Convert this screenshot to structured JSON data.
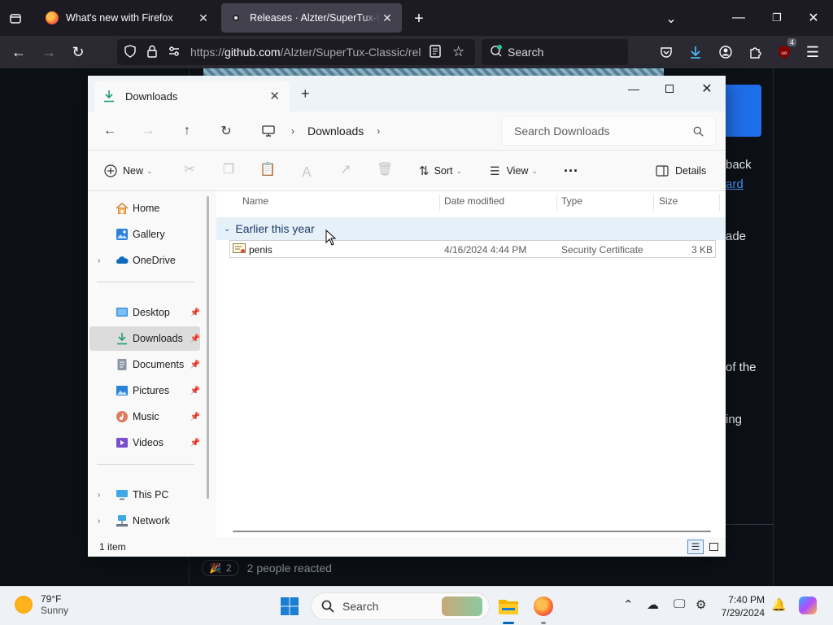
{
  "browser": {
    "tabs": [
      {
        "title": "What's new with Firefox",
        "active": false
      },
      {
        "title": "Releases · Alzter/SuperTux-Classic",
        "active": true
      }
    ],
    "url": "https://github.com/Alzter/SuperTux-Classic/rel",
    "url_host": "github.com",
    "url_prefix": "https://",
    "url_path": "/Alzter/SuperTux-Classic/rel",
    "search_placeholder": "Search",
    "extension_badge": "4"
  },
  "webpage": {
    "fragments": [
      "back",
      "ard",
      "ade",
      "of the",
      "ing"
    ],
    "reaction_count": "2",
    "reaction_text": "2 people reacted"
  },
  "explorer": {
    "tab_title": "Downloads",
    "breadcrumb": [
      "Downloads"
    ],
    "search_placeholder": "Search Downloads",
    "toolbar": {
      "new": "New",
      "sort": "Sort",
      "view": "View",
      "details": "Details"
    },
    "sidebar": {
      "top": [
        "Home",
        "Gallery",
        "OneDrive"
      ],
      "pinned": [
        "Desktop",
        "Downloads",
        "Documents",
        "Pictures",
        "Music",
        "Videos"
      ],
      "bottom": [
        "This PC",
        "Network"
      ],
      "selected": "Downloads"
    },
    "columns": [
      "Name",
      "Date modified",
      "Type",
      "Size"
    ],
    "group": "Earlier this year",
    "files": [
      {
        "name": "penis",
        "date": "4/16/2024 4:44 PM",
        "type": "Security Certificate",
        "size": "3 KB"
      }
    ],
    "status": "1 item"
  },
  "taskbar": {
    "weather_temp": "79°F",
    "weather_desc": "Sunny",
    "search_placeholder": "Search",
    "time": "7:40 PM",
    "date": "7/29/2024"
  },
  "colors": {
    "firefox_bg": "#1c1b22",
    "github_bg": "#0d1117",
    "explorer_bg": "#f9f9f9",
    "group_header": "#e6f0f8",
    "accent": "#0067c0"
  }
}
